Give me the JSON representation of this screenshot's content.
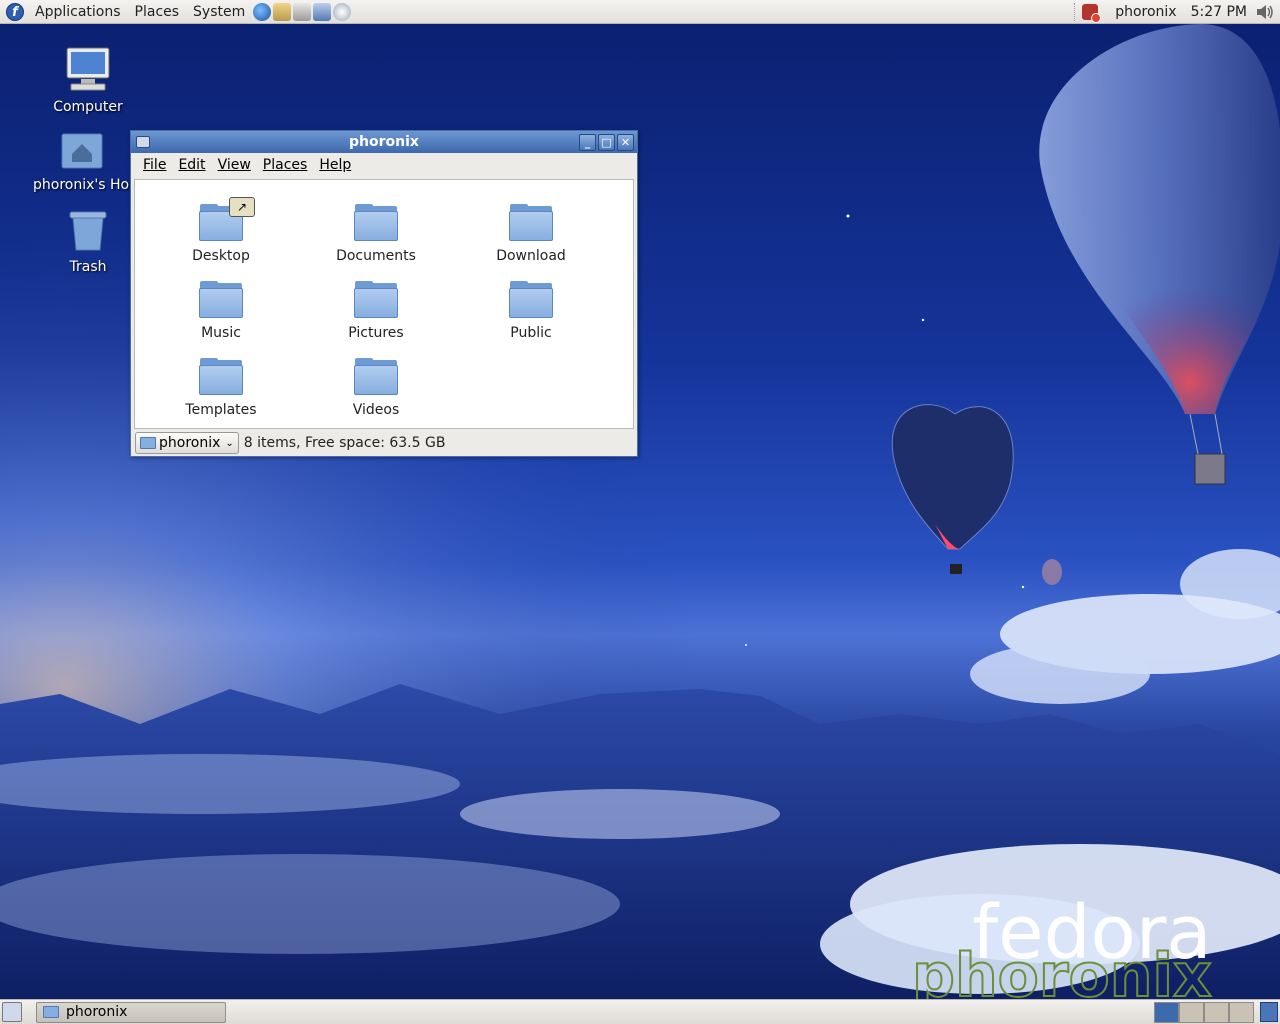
{
  "top_panel": {
    "menus": [
      "Applications",
      "Places",
      "System"
    ],
    "launchers": [
      "web-browser-icon",
      "email-icon",
      "office-icon",
      "network-icon",
      "help-icon"
    ],
    "user": "phoronix",
    "clock": "5:27 PM"
  },
  "desktop": {
    "icons": [
      {
        "label": "Computer",
        "icon": "computer-icon"
      },
      {
        "label": "phoronix's Hon",
        "icon": "home-folder-icon"
      },
      {
        "label": "Trash",
        "icon": "trash-icon"
      }
    ]
  },
  "file_manager": {
    "title": "phoronix",
    "menus": [
      "File",
      "Edit",
      "View",
      "Places",
      "Help"
    ],
    "folders": [
      "Desktop",
      "Documents",
      "Download",
      "Music",
      "Pictures",
      "Public",
      "Templates",
      "Videos"
    ],
    "path_button": "phoronix",
    "status": "8 items, Free space: 63.5 GB"
  },
  "bottom_panel": {
    "task": "phoronix"
  },
  "watermark": {
    "brand": "fedora",
    "site": "phoronix"
  },
  "colors": {
    "sky_top": "#0a1f6e",
    "titlebar": "#3d69ad",
    "folder": "#86aee0"
  }
}
